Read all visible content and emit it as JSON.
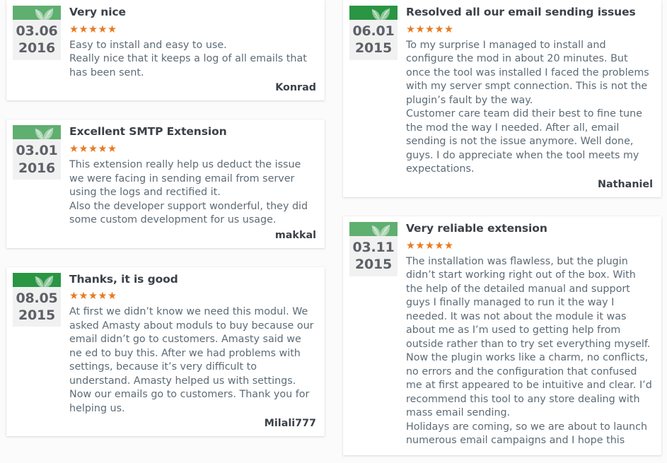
{
  "theme": {
    "page_background": "#fbfbfb",
    "card_background": "#ffffff",
    "meta_background": "#f1f1f1",
    "star_color": "#e87b22",
    "title_color": "#3b4149",
    "body_color": "#5d6b76",
    "badge_green_light": "#5faf70",
    "badge_green_dark": "#2a9543"
  },
  "icons": {
    "leaf": "leaf-icon",
    "star": "★"
  },
  "columns": {
    "left": [
      {
        "id": "review-very-nice",
        "badge_color": "#5faf70",
        "date_day": "03.06",
        "date_year": "2016",
        "title": "Very nice",
        "stars": "★★★★★",
        "rating": 5,
        "body": "Easy to install and easy to use.\nReally nice that it keeps a log of all emails that has been sent.",
        "author": "Konrad",
        "clipped": false
      },
      {
        "id": "review-excellent-smtp-extension",
        "badge_color": "#5faf70",
        "date_day": "03.01",
        "date_year": "2016",
        "title": "Excellent SMTP Extension",
        "stars": "★★★★★",
        "rating": 5,
        "body": "This extension really help us deduct the issue we were facing in sending email from server using the logs and rectified it.\nAlso the developer support wonderful, they did some custom development for us usage.",
        "author": "makkal",
        "clipped": false
      },
      {
        "id": "review-thanks-it-is-good",
        "badge_color": "#2a9543",
        "date_day": "08.05",
        "date_year": "2015",
        "title": "Thanks, it is good",
        "stars": "★★★★★",
        "rating": 5,
        "body": "At first we didn’t know we need this modul. We asked Amasty about moduls to buy because our email didn’t go to customers. Amasty said we ne ed to buy this. After we had problems with settings, because it’s very difficult to understand. Amasty helped us with settings. Now our emails go to customers. Thank you for helping us.",
        "author": "Milali777",
        "clipped": false
      }
    ],
    "right": [
      {
        "id": "review-resolved-all-our-email-sending-issues",
        "badge_color": "#2a9543",
        "date_day": "06.01",
        "date_year": "2015",
        "title": "Resolved all our email sending issues",
        "stars": "★★★★★",
        "rating": 5,
        "body": "To my surprise I managed to install and configure the mod in about 20 minutes. But once the tool was installed I faced the problems with my server smpt connection. This is not the plugin’s fault by the way.\nCustomer care team did their best to fine tune the mod the way I needed. After all, email sending is not the issue anymore. Well done, guys. I do appreciate when the tool meets my expectations.",
        "author": "Nathaniel",
        "clipped": false
      },
      {
        "id": "review-very-reliable-extension",
        "badge_color": "#5faf70",
        "date_day": "03.11",
        "date_year": "2015",
        "title": "Very reliable extension",
        "stars": "★★★★★",
        "rating": 5,
        "body": "The installation was flawless, but the plugin didn’t start working right out of the box. With the help of the detailed manual and support guys I finally managed to run it the way I needed. It was not about the module it was about me as I’m used to getting help from outside rather than to try set everything myself. Now the plugin works like a charm, no conflicts, no errors and the configuration that confused me at first appeared to be intuitive and clear. I’d recommend this tool to any store dealing with mass email sending.\nHolidays are coming, so we are about to launch numerous email campaigns and I hope this",
        "author": "",
        "clipped": true
      }
    ]
  }
}
